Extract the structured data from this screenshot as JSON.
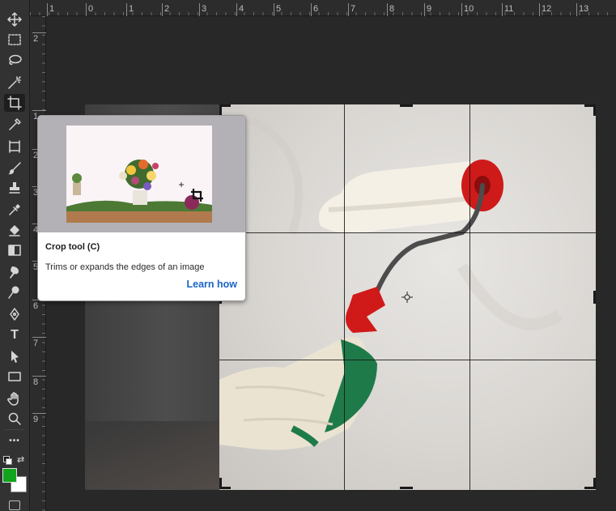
{
  "rulers": {
    "top": [
      "1",
      "0",
      "1",
      "2",
      "3",
      "4",
      "5",
      "6",
      "7",
      "8",
      "9",
      "10",
      "11",
      "12",
      "13"
    ],
    "left": [
      "2",
      "",
      "",
      "",
      "",
      "",
      "",
      "",
      "",
      "",
      "",
      "",
      "",
      "",
      "",
      "",
      "",
      "5",
      "",
      "",
      "",
      "",
      "",
      "",
      "8",
      "9"
    ],
    "left_visible": [
      "2",
      "1",
      "2",
      "3",
      "4",
      "5",
      "6",
      "7",
      "8",
      "9"
    ]
  },
  "toolbar": {
    "tools": [
      {
        "icon": "move-icon",
        "label": "Move"
      },
      {
        "icon": "rectangular-marquee-icon",
        "label": "Rectangular Marquee"
      },
      {
        "icon": "lasso-icon",
        "label": "Lasso"
      },
      {
        "icon": "magic-wand-icon",
        "label": "Magic Wand"
      },
      {
        "icon": "crop-icon",
        "label": "Crop",
        "active": true
      },
      {
        "icon": "eyedropper-icon",
        "label": "Eyedropper"
      },
      {
        "icon": "frame-icon",
        "label": "Frame"
      },
      {
        "icon": "brush-icon",
        "label": "Brush"
      },
      {
        "icon": "clone-stamp-icon",
        "label": "Clone Stamp"
      },
      {
        "icon": "healing-icon",
        "label": "Spot Healing"
      },
      {
        "icon": "eraser-icon",
        "label": "Eraser"
      },
      {
        "icon": "gradient-icon",
        "label": "Gradient"
      },
      {
        "icon": "smudge-icon",
        "label": "Smudge"
      },
      {
        "icon": "dodge-icon",
        "label": "Dodge"
      },
      {
        "icon": "pen-icon",
        "label": "Pen"
      },
      {
        "icon": "type-icon",
        "label": "Type",
        "glyph": "T"
      },
      {
        "icon": "path-selection-icon",
        "label": "Path Selection"
      },
      {
        "icon": "rectangle-shape-icon",
        "label": "Rectangle"
      },
      {
        "icon": "hand-icon",
        "label": "Hand"
      },
      {
        "icon": "zoom-icon",
        "label": "Zoom"
      },
      {
        "icon": "more-icon",
        "label": "More",
        "glyph": "•••"
      }
    ],
    "foreground_color": "#11a51d",
    "background_color": "#ffffff"
  },
  "tooltip": {
    "title": "Crop tool (C)",
    "description": "Trims or expands the edges of an image",
    "link": "Learn how"
  },
  "colors": {
    "tooltip_link": "#1b64c8",
    "roller_red": "#d01818",
    "glove_green": "#1f7a4a"
  }
}
